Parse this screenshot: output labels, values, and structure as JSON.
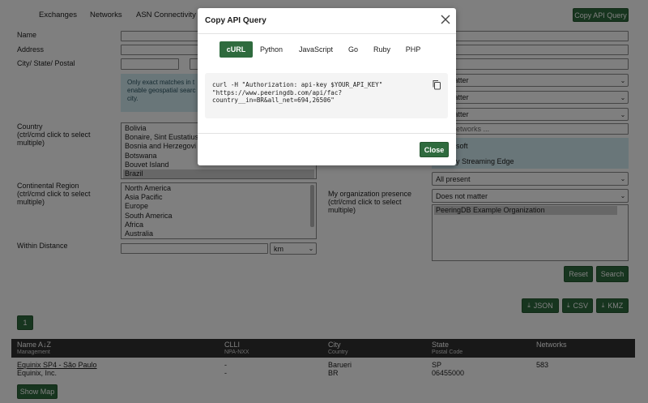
{
  "nav": {
    "items": [
      "Exchanges",
      "Networks",
      "ASN Connectivity"
    ],
    "copy_api_query": "Copy API Query"
  },
  "form": {
    "name_label": "Name",
    "address_label": "Address",
    "city_label": "City/ State/ Postal",
    "info_text_1": "Only exact matches in t",
    "info_text_2": "enable geospatial searc",
    "info_text_3": "city.",
    "country_label": "Country\n(ctrl/cmd click to select\nmultiple)",
    "countries": [
      "Bolivia",
      "Bonaire, Sint Eustatius",
      "Bosnia and Herzegovi",
      "Botswana",
      "Bouvet Island",
      "Brazil"
    ],
    "region_label": "Continental Region\n(ctrl/cmd click to select\nmultiple)",
    "regions": [
      "North America",
      "Asia Pacific",
      "Europe",
      "South America",
      "Africa",
      "Australia"
    ],
    "distance_label": "Within Distance",
    "distance_unit": "km",
    "selects_right": [
      "not matter",
      "not matter",
      "not matter"
    ],
    "networks_placeholder": "networks ...",
    "net_options": [
      "soft",
      "y Streaming Edge"
    ],
    "all_present": "All present",
    "org_presence_label": "My organization presence\n(ctrl/cmd click to select\nmultiple)",
    "does_not_matter": "Does not matter",
    "org_list": [
      "PeeringDB Example Organization"
    ],
    "reset": "Reset",
    "search": "Search"
  },
  "export": {
    "json": "JSON",
    "csv": "CSV",
    "kmz": "KMZ"
  },
  "pagination": {
    "page": "1"
  },
  "table": {
    "headers": [
      {
        "main": "Name A↓Z",
        "sub": "Management"
      },
      {
        "main": "CLLI",
        "sub": "NPA-NXX"
      },
      {
        "main": "City",
        "sub": "Country"
      },
      {
        "main": "State",
        "sub": "Postal Code"
      },
      {
        "main": "Networks",
        "sub": ""
      }
    ],
    "rows": [
      {
        "name": "Equinix SP4 - São Paulo",
        "mgmt": "Equinix, Inc.",
        "clli": "-",
        "npa": "-",
        "city": "Barueri",
        "country": "BR",
        "state": "SP",
        "postal": "06455000",
        "networks": "583"
      }
    ]
  },
  "show_map": "Show Map",
  "modal": {
    "title": "Copy API Query",
    "tabs": [
      "cURL",
      "Python",
      "JavaScript",
      "Go",
      "Ruby",
      "PHP"
    ],
    "active_tab": "cURL",
    "code": "curl -H \"Authorization: api-key $YOUR_API_KEY\"\n\"https://www.peeringdb.com/api/fac?\ncountry__in=BR&all_net=694,26506\"",
    "close": "Close"
  },
  "colors": {
    "accent": "#2f6b3e",
    "overlay": "rgba(0,0,0,0.5)",
    "table_header": "#303030"
  }
}
